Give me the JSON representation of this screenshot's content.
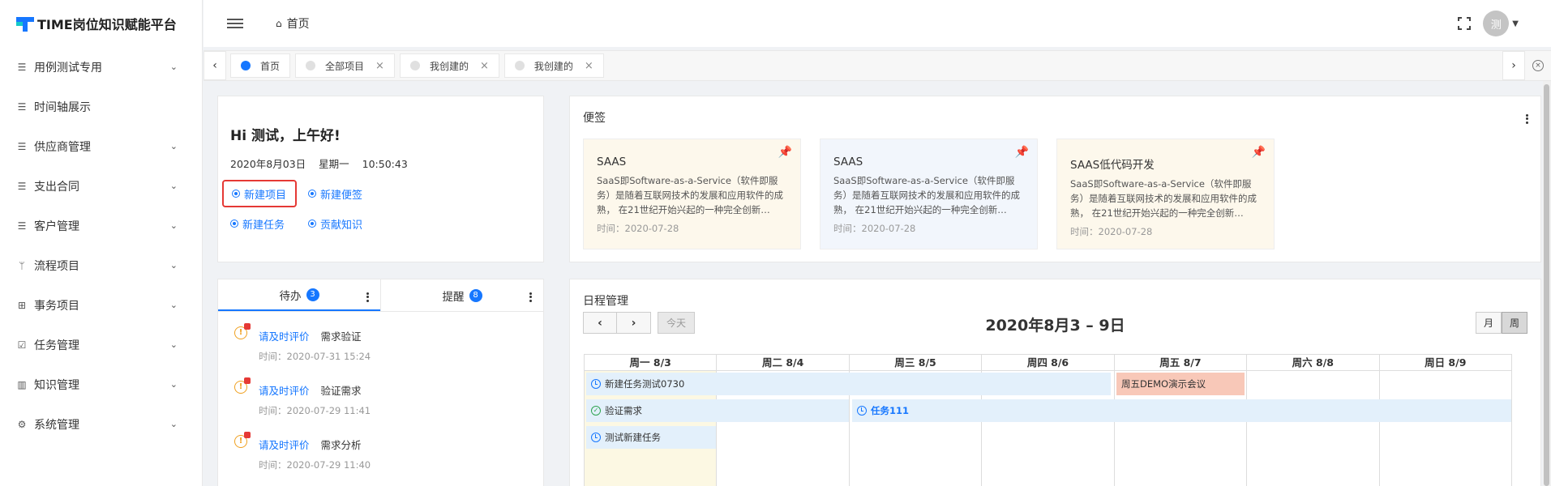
{
  "app": {
    "title": "TIME岗位知识赋能平台"
  },
  "sidebar": {
    "items": [
      {
        "label": "用例测试专用",
        "icon": "menu-lines-icon",
        "expandable": true
      },
      {
        "label": "时间轴展示",
        "icon": "menu-lines-icon",
        "expandable": false
      },
      {
        "label": "供应商管理",
        "icon": "menu-lines-icon",
        "expandable": true
      },
      {
        "label": "支出合同",
        "icon": "menu-lines-icon",
        "expandable": true
      },
      {
        "label": "客户管理",
        "icon": "menu-lines-icon",
        "expandable": true
      },
      {
        "label": "流程项目",
        "icon": "branch-icon",
        "expandable": true
      },
      {
        "label": "事务项目",
        "icon": "grid-icon",
        "expandable": true
      },
      {
        "label": "任务管理",
        "icon": "checklist-icon",
        "expandable": true
      },
      {
        "label": "知识管理",
        "icon": "book-icon",
        "expandable": true
      },
      {
        "label": "系统管理",
        "icon": "gear-icon",
        "expandable": true
      }
    ]
  },
  "header": {
    "breadcrumb_home": "首页",
    "avatar_text": "测"
  },
  "tabs": [
    {
      "label": "首页",
      "active": true,
      "closable": false
    },
    {
      "label": "全部项目",
      "active": false,
      "closable": true
    },
    {
      "label": "我创建的",
      "active": false,
      "closable": true
    },
    {
      "label": "我创建的",
      "active": false,
      "closable": true
    }
  ],
  "greeting": {
    "title": "Hi 测试，上午好!",
    "date": "2020年8月03日",
    "weekday": "星期一",
    "time": "10:50:43",
    "actions": [
      "新建项目",
      "新建便签",
      "新建任务",
      "贡献知识"
    ]
  },
  "notes": {
    "title": "便签",
    "cards": [
      {
        "title": "SAAS",
        "body": "SaaS即Software-as-a-Service（软件即服务）是随着互联网技术的发展和应用软件的成熟， 在21世纪开始兴起的一种完全创新…",
        "time": "时间：2020-07-28",
        "pin_color": "#e6a23c"
      },
      {
        "title": "SAAS",
        "body": "SaaS即Software-as-a-Service（软件即服务）是随着互联网技术的发展和应用软件的成熟， 在21世纪开始兴起的一种完全创新…",
        "time": "时间：2020-07-28",
        "pin_color": "#1677ff"
      },
      {
        "title": "SAAS低代码开发",
        "body": "SaaS即Software-as-a-Service（软件即服务）是随着互联网技术的发展和应用软件的成熟， 在21世纪开始兴起的一种完全创新…",
        "time": "时间：2020-07-28",
        "pin_color": "#e6a23c"
      }
    ]
  },
  "todo": {
    "tabs": [
      {
        "label": "待办",
        "count": "3"
      },
      {
        "label": "提醒",
        "count": "8"
      }
    ],
    "items": [
      {
        "link": "请及时评价",
        "text": "需求验证",
        "time": "时间：2020-07-31 15:24"
      },
      {
        "link": "请及时评价",
        "text": "验证需求",
        "time": "时间：2020-07-29 11:41"
      },
      {
        "link": "请及时评价",
        "text": "需求分析",
        "time": "时间：2020-07-29 11:40"
      }
    ]
  },
  "schedule": {
    "title": "日程管理",
    "today": "今天",
    "range_title": "2020年8月3 – 9日",
    "views": [
      "月",
      "周"
    ],
    "active_view": "周",
    "days": [
      "周一 8/3",
      "周二 8/4",
      "周三 8/5",
      "周四 8/6",
      "周五 8/7",
      "周六 8/8",
      "周日 8/9"
    ],
    "events": [
      {
        "title": "新建任务测试0730",
        "icon": "clock-icon"
      },
      {
        "title": "周五DEMO演示会议",
        "icon": ""
      },
      {
        "title": "验证需求",
        "icon": "check-circle-icon"
      },
      {
        "title": "任务111",
        "icon": "clock-icon"
      },
      {
        "title": "测试新建任务",
        "icon": "clock-icon"
      }
    ]
  },
  "colors": {
    "primary": "#1677ff",
    "warning": "#f0a020",
    "danger": "#e53935",
    "note_yellow": "#fdf8ec",
    "note_blue": "#f2f6fc",
    "event_blue": "#e3f0fb",
    "event_red": "#f8c8b8"
  }
}
